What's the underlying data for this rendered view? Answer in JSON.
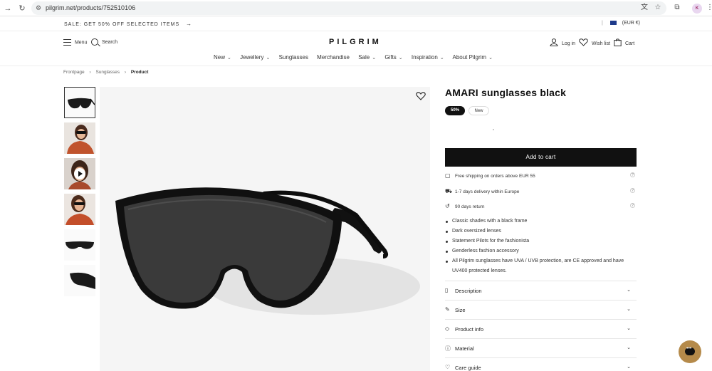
{
  "browser": {
    "url": "pilgrim.net/products/752510106",
    "profile_initials": "K"
  },
  "announcement": {
    "text": "SALE: GET 50% OFF SELECTED ITEMS",
    "arrow": "→"
  },
  "currency": "(EUR €)",
  "header": {
    "menu_label": "Menu",
    "search_label": "Search",
    "logo": "PILGRIM",
    "login_label": "Log in",
    "wishlist_label": "Wish list",
    "cart_label": "Cart"
  },
  "nav": [
    {
      "label": "New",
      "has_dropdown": true
    },
    {
      "label": "Jewellery",
      "has_dropdown": true
    },
    {
      "label": "Sunglasses",
      "has_dropdown": false
    },
    {
      "label": "Merchandise",
      "has_dropdown": false
    },
    {
      "label": "Sale",
      "has_dropdown": true
    },
    {
      "label": "Gifts",
      "has_dropdown": true
    },
    {
      "label": "Inspiration",
      "has_dropdown": true
    },
    {
      "label": "About Pilgrim",
      "has_dropdown": true
    }
  ],
  "breadcrumb": [
    "Frontpage",
    "Sunglasses",
    "Product"
  ],
  "product": {
    "title": "AMARI sunglasses black",
    "badges": [
      "50%",
      "New"
    ],
    "add_to_cart": "Add to cart",
    "usps": [
      {
        "icon": "box-icon",
        "text": "Free shipping on orders above EUR 55"
      },
      {
        "icon": "truck-icon",
        "text": "1-7 days delivery within Europe"
      },
      {
        "icon": "return-icon",
        "text": "90 days return"
      }
    ],
    "features": [
      "Classic shades with a black frame",
      "Dark oversized lenses",
      "Statement Pilots for the fashionista",
      "Genderless fashion accessory",
      "All Pilgrim sunglasses have UVA / UVB protection, are CE approved and have UV400 protected lenses."
    ],
    "accordions": [
      {
        "icon": "document-icon",
        "label": "Description"
      },
      {
        "icon": "ruler-icon",
        "label": "Size"
      },
      {
        "icon": "tag-icon",
        "label": "Product info"
      },
      {
        "icon": "info-icon",
        "label": "Material"
      },
      {
        "icon": "heart-icon",
        "label": "Care guide"
      }
    ]
  },
  "colors": {
    "accent": "#111111",
    "chat_button": "#b58a4a"
  }
}
